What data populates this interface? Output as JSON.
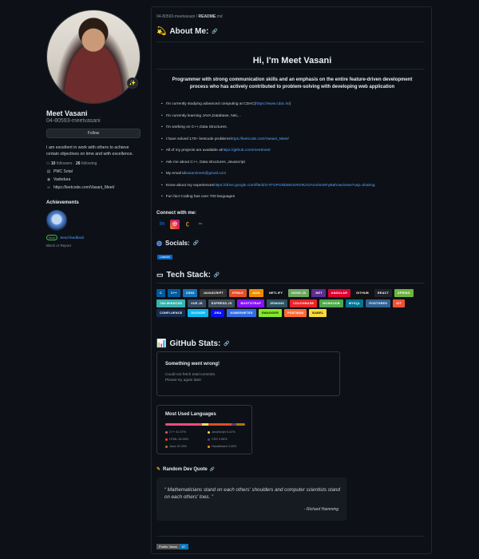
{
  "profile": {
    "name": "Meet Vasani",
    "login": "04-80593-meetvasani",
    "avatar_emoji": "✨",
    "follow_label": "Follow",
    "bio": "I am excellent in work with others to achieve certain objectives on time and with excellence.",
    "followers_count": "10",
    "followers_label": "followers",
    "following_count": "26",
    "following_label": "following",
    "details": [
      {
        "icon": "building-icon",
        "glyph": "▤",
        "text": "PMC Sotal"
      },
      {
        "icon": "location-icon",
        "glyph": "◉",
        "text": "Vadodara"
      },
      {
        "icon": "link-icon",
        "glyph": "∞",
        "text": "https://leetcode.com/Vasani_Meet/"
      }
    ],
    "achievements_title": "Achievements",
    "beta_label": "Beta",
    "feedback_label": "Send feedback",
    "block_label": "Block or Report"
  },
  "readme": {
    "breadcrumb_user": "04-80593-meetvasani",
    "breadcrumb_sep": " / ",
    "breadcrumb_file": "README",
    "breadcrumb_ext": ".md",
    "about_title": "About Me:",
    "about_emoji": "💫",
    "hello": "Hi, I'm Meet Vasani",
    "intro": "Programmer with strong communication skills and an emphasis on the entire feature-driven development process who has actively contributed to problem-solving with developing web application",
    "bullets": [
      {
        "text": "I'm currently studying advanced computing at CDAC(",
        "link": "https://www.cdac.in/",
        "after": ")"
      },
      {
        "text": "I'm currently learning JAVA,Database, Net,...",
        "link": "",
        "after": ""
      },
      {
        "text": "I'm working on C++,Data Structures.",
        "link": "",
        "after": ""
      },
      {
        "text": "I have solved 170+ leetcode problems ",
        "link": "https://leetcode.com/Vasani_Meet/",
        "after": ""
      },
      {
        "text": "All of my projects are available at ",
        "link": "https://github.com/meetmeet",
        "after": ""
      },
      {
        "text": "Ask me about C++, Data structures ,Javascript",
        "link": "",
        "after": ""
      },
      {
        "text": "My email id ",
        "link": "vasanimeet@gmail.com",
        "after": ""
      },
      {
        "text": "Know about my experiences ",
        "link": "https://drive.google.com/file/d/1rYFGPGNbMGGROIK2ctAnVisntXFyBahnav/view?usp=sharing",
        "after": ""
      },
      {
        "text": "Fun fact Coding has over 700 languages",
        "link": "",
        "after": ""
      }
    ],
    "connect_title": "Connect with me:",
    "socials_title": "Socials:",
    "linkedin_label": "LinkedIn",
    "tech_title": "Tech Stack:",
    "tech": [
      {
        "label": "C",
        "color": "#00599c"
      },
      {
        "label": "C++",
        "color": "#00599c"
      },
      {
        "label": "CSS3",
        "color": "#1572b6"
      },
      {
        "label": "JavaScript",
        "color": "#323330"
      },
      {
        "label": "HTML5",
        "color": "#e34f26"
      },
      {
        "label": "Java",
        "color": "#ed8b00"
      },
      {
        "label": "Netlify",
        "color": "#0d1117"
      },
      {
        "label": "Node.js",
        "color": "#6da55f"
      },
      {
        "label": ".Net",
        "color": "#5c2d91"
      },
      {
        "label": "Angular",
        "color": "#dd0031"
      },
      {
        "label": "GitHub",
        "color": "#121011"
      },
      {
        "label": "React",
        "color": "#20232a"
      },
      {
        "label": "Spring",
        "color": "#6db33f"
      },
      {
        "label": "TailwindCSS",
        "color": "#38b2ac"
      },
      {
        "label": "Vue.js",
        "color": "#35495e"
      },
      {
        "label": "Express.js",
        "color": "#404d59"
      },
      {
        "label": "Bootstrap",
        "color": "#8511fa"
      },
      {
        "label": "Jenkins",
        "color": "#2c5263"
      },
      {
        "label": "Couchbase",
        "color": "#ea2328"
      },
      {
        "label": "MongoDB",
        "color": "#4ea94b"
      },
      {
        "label": "MySQL",
        "color": "#00758f"
      },
      {
        "label": "Postgres",
        "color": "#316192"
      },
      {
        "label": "Git",
        "color": "#f05033"
      },
      {
        "label": "Confluence",
        "color": "#172b4d"
      },
      {
        "label": "Docker",
        "color": "#0db7ed"
      },
      {
        "label": "Jira",
        "color": "#0a0fff"
      },
      {
        "label": "Kubernetes",
        "color": "#326ce5"
      },
      {
        "label": "Swagger",
        "color": "#85ea2d"
      },
      {
        "label": "Postman",
        "color": "#ff6c37"
      },
      {
        "label": "Babel",
        "color": "#f9dc3e"
      }
    ],
    "stats_title": "GitHub Stats:",
    "stats_emoji": "📊",
    "error_title": "Something went wrong!",
    "error_msg_1": "Could not fetch total commits.",
    "error_msg_2": "Please try again later",
    "langs_title": "Most Used Languages",
    "languages": [
      {
        "name": "C++",
        "pct": "41.57%",
        "value": 41.57,
        "color": "#f34b7d"
      },
      {
        "name": "JavaScript",
        "pct": "6.41%",
        "value": 6.41,
        "color": "#f1e05a"
      },
      {
        "name": "HTML",
        "pct": "26.55%",
        "value": 26.55,
        "color": "#e34c26"
      },
      {
        "name": "CSS",
        "pct": "4.96%",
        "value": 4.96,
        "color": "#563d7c"
      },
      {
        "name": "Java",
        "pct": "10.03%",
        "value": 10.03,
        "color": "#b07219"
      },
      {
        "name": "Handlebars",
        "pct": "0.00%",
        "value": 0.0,
        "color": "#f7931e"
      }
    ],
    "quote_title": "Random Dev Quote",
    "quote_text": "Mathematicians stand on each others' shoulders and computer scientists stand on each others' toes.",
    "quote_author": "- Richard Hamming",
    "views_label": "Profile Views",
    "views_count": "87"
  }
}
